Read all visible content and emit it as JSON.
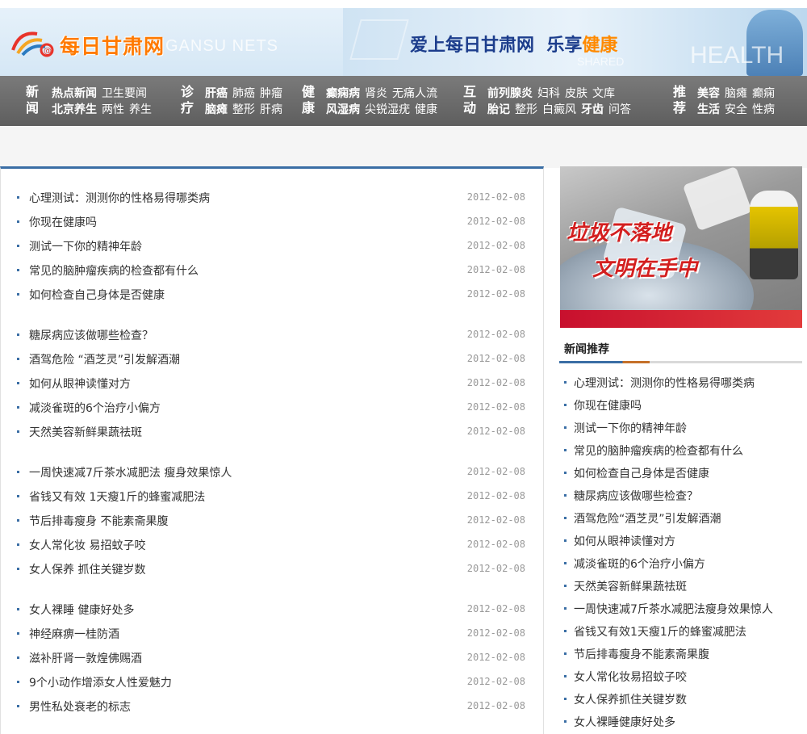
{
  "header": {
    "logo_text": "每日甘肃网",
    "watermark_left": "GANSU NETS",
    "slogan_part1": "爱上每日甘肃网",
    "slogan_part2": "乐享",
    "slogan_highlight": "健康",
    "watermark_right": "HEALTH",
    "watermark_small": "SHARED"
  },
  "nav": {
    "groups": [
      {
        "category": [
          "新",
          "闻"
        ],
        "row1": [
          {
            "t": "热点新闻",
            "b": true
          },
          {
            "t": "卫生要闻",
            "b": false
          }
        ],
        "row2": [
          {
            "t": "北京养生",
            "b": true
          },
          {
            "t": "两性",
            "b": false
          },
          {
            "t": "养生",
            "b": false
          }
        ]
      },
      {
        "category": [
          "诊",
          "疗"
        ],
        "row1": [
          {
            "t": "肝癌",
            "b": true
          },
          {
            "t": "肺癌",
            "b": false
          },
          {
            "t": "肿瘤",
            "b": false
          }
        ],
        "row2": [
          {
            "t": "脑瘫",
            "b": true
          },
          {
            "t": "整形",
            "b": false
          },
          {
            "t": "肝病",
            "b": false
          }
        ]
      },
      {
        "category": [
          "健",
          "康"
        ],
        "row1": [
          {
            "t": "癫痫病",
            "b": true
          },
          {
            "t": "肾炎",
            "b": false
          },
          {
            "t": "无痛人流",
            "b": false
          }
        ],
        "row2": [
          {
            "t": "风湿病",
            "b": true
          },
          {
            "t": "尖锐湿疣",
            "b": false
          },
          {
            "t": "健康",
            "b": false
          }
        ]
      },
      {
        "category": [
          "互",
          "动"
        ],
        "row1": [
          {
            "t": "前列腺炎",
            "b": true
          },
          {
            "t": "妇科",
            "b": false
          },
          {
            "t": "皮肤",
            "b": false
          },
          {
            "t": "文库",
            "b": false
          }
        ],
        "row2": [
          {
            "t": "胎记",
            "b": true
          },
          {
            "t": "整形",
            "b": false
          },
          {
            "t": "白癜风",
            "b": false
          },
          {
            "t": "牙齿",
            "b": true
          },
          {
            "t": "问答",
            "b": false
          }
        ]
      },
      {
        "category": [
          "推",
          "荐"
        ],
        "row1": [
          {
            "t": "美容",
            "b": true
          },
          {
            "t": "脑瘫",
            "b": false
          },
          {
            "t": "癫痫",
            "b": false
          }
        ],
        "row2": [
          {
            "t": "生活",
            "b": true
          },
          {
            "t": "安全",
            "b": false
          },
          {
            "t": "性病",
            "b": false
          }
        ]
      }
    ]
  },
  "news_list": {
    "items": [
      {
        "title": "心理测试：测测你的性格易得哪类病",
        "date": "2012-02-08"
      },
      {
        "title": "你现在健康吗",
        "date": "2012-02-08"
      },
      {
        "title": "测试一下你的精神年龄",
        "date": "2012-02-08"
      },
      {
        "title": "常见的脑肿瘤疾病的检查都有什么",
        "date": "2012-02-08"
      },
      {
        "title": "如何检查自己身体是否健康",
        "date": "2012-02-08"
      },
      {
        "title": "糖尿病应该做哪些检查？",
        "date": "2012-02-08"
      },
      {
        "title": "酒驾危险 “酒芝灵”引发解酒潮",
        "date": "2012-02-08"
      },
      {
        "title": "如何从眼神读懂对方",
        "date": "2012-02-08"
      },
      {
        "title": "减淡雀斑的6个治疗小偏方",
        "date": "2012-02-08"
      },
      {
        "title": "天然美容新鲜果蔬祛斑",
        "date": "2012-02-08"
      },
      {
        "title": "一周快速减7斤茶水减肥法 瘦身效果惊人",
        "date": "2012-02-08"
      },
      {
        "title": "省钱又有效 1天瘦1斤的蜂蜜减肥法",
        "date": "2012-02-08"
      },
      {
        "title": "节后排毒瘦身 不能素斋果腹",
        "date": "2012-02-08"
      },
      {
        "title": "女人常化妆 易招蚊子咬",
        "date": "2012-02-08"
      },
      {
        "title": "女人保养 抓住关键岁数",
        "date": "2012-02-08"
      },
      {
        "title": "女人裸睡 健康好处多",
        "date": "2012-02-08"
      },
      {
        "title": "神经麻痹一桂防酒",
        "date": "2012-02-08"
      },
      {
        "title": "滋补肝肾一敦煌佛赐酒",
        "date": "2012-02-08"
      },
      {
        "title": "9个小动作增添女人性爱魅力",
        "date": "2012-02-08"
      },
      {
        "title": "男性私处衰老的标志",
        "date": "2012-02-08"
      }
    ]
  },
  "sidebar": {
    "photo_caption_1": "垃圾不落地",
    "photo_caption_2": "文明在手中",
    "recommend_title": "新闻推荐",
    "recommend_items": [
      "心理测试：测测你的性格易得哪类病",
      "你现在健康吗",
      "测试一下你的精神年龄",
      "常见的脑肿瘤疾病的检查都有什么",
      "如何检查自己身体是否健康",
      "糖尿病应该做哪些检查？",
      "酒驾危险“酒芝灵”引发解酒潮",
      "如何从眼神读懂对方",
      "减淡雀斑的6个治疗小偏方",
      "天然美容新鲜果蔬祛斑",
      "一周快速减7斤茶水减肥法瘦身效果惊人",
      "省钱又有效1天瘦1斤的蜂蜜减肥法",
      "节后排毒瘦身不能素斋果腹",
      "女人常化妆易招蚊子咬",
      "女人保养抓住关键岁数",
      "女人裸睡健康好处多"
    ]
  },
  "colors": {
    "accent_blue": "#3a6ea5",
    "nav_gray": "#6a6a6a",
    "logo_orange": "#ff7a00",
    "caption_red": "#d31f1f"
  }
}
